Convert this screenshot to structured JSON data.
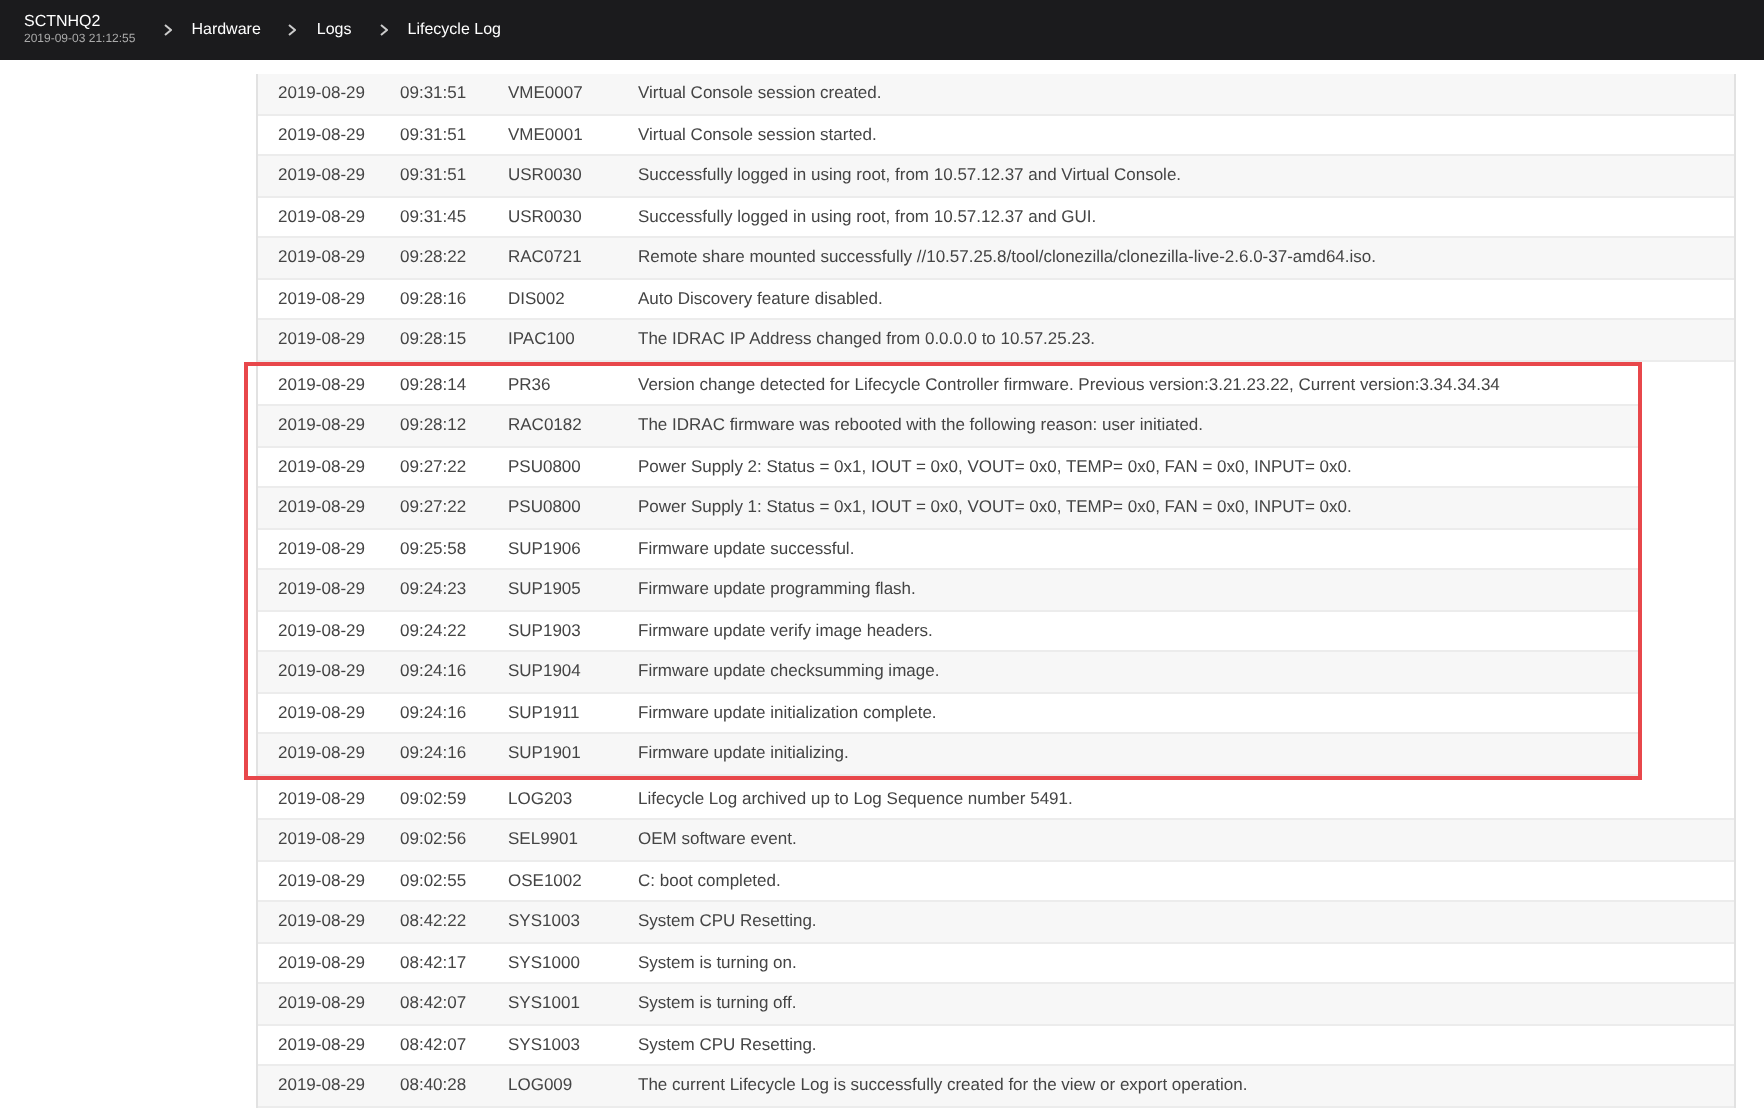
{
  "header": {
    "host": "SCTNHQ2",
    "datetime": "2019-09-03 21:12:55",
    "breadcrumbs": [
      "Hardware",
      "Logs",
      "Lifecycle Log"
    ]
  },
  "log_groups": [
    {
      "kind": "plain",
      "rows": [
        {
          "date": "2019-08-29",
          "time": "09:31:51",
          "message_id": "VME0007",
          "description": "Virtual Console session created."
        },
        {
          "date": "2019-08-29",
          "time": "09:31:51",
          "message_id": "VME0001",
          "description": "Virtual Console session started."
        },
        {
          "date": "2019-08-29",
          "time": "09:31:51",
          "message_id": "USR0030",
          "description": "Successfully logged in using root, from 10.57.12.37 and Virtual Console."
        },
        {
          "date": "2019-08-29",
          "time": "09:31:45",
          "message_id": "USR0030",
          "description": "Successfully logged in using root, from 10.57.12.37 and GUI."
        },
        {
          "date": "2019-08-29",
          "time": "09:28:22",
          "message_id": "RAC0721",
          "description": "Remote share mounted successfully //10.57.25.8/tool/clonezilla/clonezilla-live-2.6.0-37-amd64.iso."
        },
        {
          "date": "2019-08-29",
          "time": "09:28:16",
          "message_id": "DIS002",
          "description": "Auto Discovery feature disabled."
        },
        {
          "date": "2019-08-29",
          "time": "09:28:15",
          "message_id": "IPAC100",
          "description": "The IDRAC IP Address changed from 0.0.0.0 to 10.57.25.23."
        }
      ]
    },
    {
      "kind": "highlight_box",
      "rows": [
        {
          "date": "2019-08-29",
          "time": "09:28:14",
          "message_id": "PR36",
          "description": "Version change detected for Lifecycle Controller firmware. Previous version:3.21.23.22, Current version:3.34.34.34"
        },
        {
          "date": "2019-08-29",
          "time": "09:28:12",
          "message_id": "RAC0182",
          "description": "The IDRAC firmware was rebooted with the following reason: user initiated."
        },
        {
          "date": "2019-08-29",
          "time": "09:27:22",
          "message_id": "PSU0800",
          "description": "Power Supply 2: Status = 0x1, IOUT = 0x0, VOUT= 0x0, TEMP= 0x0, FAN = 0x0, INPUT= 0x0."
        },
        {
          "date": "2019-08-29",
          "time": "09:27:22",
          "message_id": "PSU0800",
          "description": "Power Supply 1: Status = 0x1, IOUT = 0x0, VOUT= 0x0, TEMP= 0x0, FAN = 0x0, INPUT= 0x0."
        },
        {
          "date": "2019-08-29",
          "time": "09:25:58",
          "message_id": "SUP1906",
          "description": "Firmware update successful."
        },
        {
          "date": "2019-08-29",
          "time": "09:24:23",
          "message_id": "SUP1905",
          "description": "Firmware update programming flash."
        },
        {
          "date": "2019-08-29",
          "time": "09:24:22",
          "message_id": "SUP1903",
          "description": "Firmware update verify image headers."
        },
        {
          "date": "2019-08-29",
          "time": "09:24:16",
          "message_id": "SUP1904",
          "description": "Firmware update checksumming image."
        },
        {
          "date": "2019-08-29",
          "time": "09:24:16",
          "message_id": "SUP1911",
          "description": "Firmware update initialization complete."
        },
        {
          "date": "2019-08-29",
          "time": "09:24:16",
          "message_id": "SUP1901",
          "description": "Firmware update initializing."
        }
      ]
    },
    {
      "kind": "plain",
      "rows": [
        {
          "date": "2019-08-29",
          "time": "09:02:59",
          "message_id": "LOG203",
          "description": "Lifecycle Log archived up to Log Sequence number 5491."
        },
        {
          "date": "2019-08-29",
          "time": "09:02:56",
          "message_id": "SEL9901",
          "description": "OEM software event."
        },
        {
          "date": "2019-08-29",
          "time": "09:02:55",
          "message_id": "OSE1002",
          "description": "C: boot completed."
        },
        {
          "date": "2019-08-29",
          "time": "08:42:22",
          "message_id": "SYS1003",
          "description": "System CPU Resetting."
        },
        {
          "date": "2019-08-29",
          "time": "08:42:17",
          "message_id": "SYS1000",
          "description": "System is turning on."
        },
        {
          "date": "2019-08-29",
          "time": "08:42:07",
          "message_id": "SYS1001",
          "description": "System is turning off."
        },
        {
          "date": "2019-08-29",
          "time": "08:42:07",
          "message_id": "SYS1003",
          "description": "System CPU Resetting."
        },
        {
          "date": "2019-08-29",
          "time": "08:40:28",
          "message_id": "LOG009",
          "description": "The current Lifecycle Log is successfully created for the view or export operation."
        }
      ]
    }
  ]
}
